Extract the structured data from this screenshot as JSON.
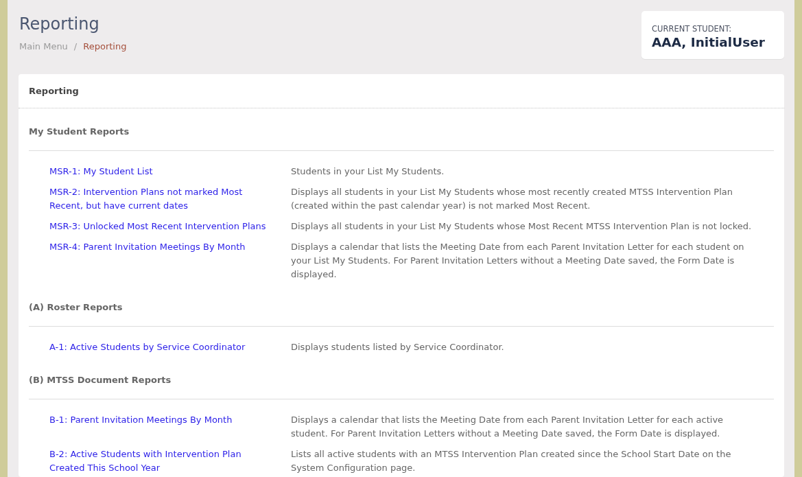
{
  "page": {
    "title": "Reporting"
  },
  "breadcrumb": {
    "separator": "/",
    "items": [
      {
        "label": "Main Menu",
        "current": false
      },
      {
        "label": "Reporting",
        "current": true
      }
    ]
  },
  "current_student": {
    "label": "CURRENT STUDENT:",
    "name": "AAA, InitialUser"
  },
  "panel": {
    "title": "Reporting",
    "sections": [
      {
        "heading": "My Student Reports",
        "reports": [
          {
            "link": "MSR-1: My Student List",
            "description": "Students in your List My Students."
          },
          {
            "link": "MSR-2: Intervention Plans not marked Most Recent, but have current dates",
            "description": "Displays all students in your List My Students whose most recently created MTSS Intervention Plan (created within the past calendar year) is not marked Most Recent."
          },
          {
            "link": "MSR-3: Unlocked Most Recent Intervention Plans",
            "description": "Displays all students in your List My Students whose Most Recent MTSS Intervention Plan is not locked."
          },
          {
            "link": "MSR-4: Parent Invitation Meetings By Month",
            "description": "Displays a calendar that lists the Meeting Date from each Parent Invitation Letter for each student on your List My Students. For Parent Invitation Letters without a Meeting Date saved, the Form Date is displayed."
          }
        ]
      },
      {
        "heading": "(A) Roster Reports",
        "reports": [
          {
            "link": "A-1: Active Students by Service Coordinator",
            "description": "Displays students listed by Service Coordinator."
          }
        ]
      },
      {
        "heading": "(B) MTSS Document Reports",
        "reports": [
          {
            "link": "B-1: Parent Invitation Meetings By Month",
            "description": "Displays a calendar that lists the Meeting Date from each Parent Invitation Letter for each active student. For Parent Invitation Letters without a Meeting Date saved, the Form Date is displayed."
          },
          {
            "link": "B-2: Active Students with Intervention Plan Created This School Year",
            "description": "Lists all active students with an MTSS Intervention Plan created since the School Start Date on the System Configuration page."
          }
        ]
      }
    ]
  }
}
